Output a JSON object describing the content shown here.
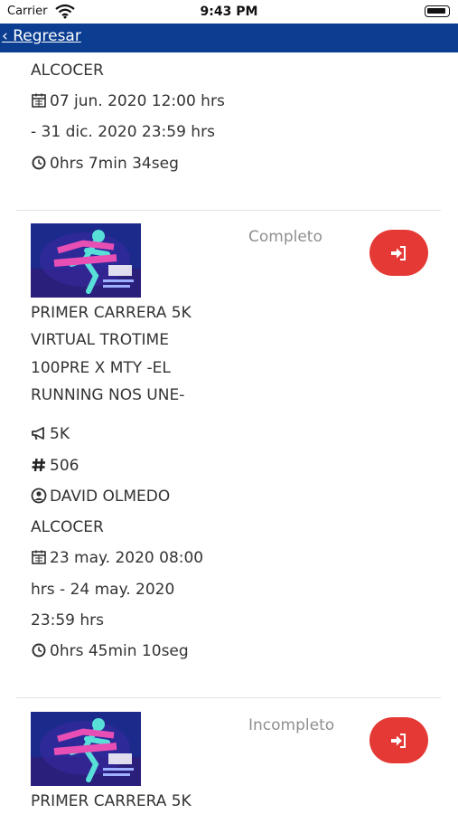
{
  "status_bar": {
    "carrier": "Carrier",
    "time": "9:43 PM"
  },
  "nav": {
    "back_label": "‹ Regresar"
  },
  "entry0": {
    "name_tail": "ALCOCER",
    "date_line1": "07 jun. 2020 12:00 hrs",
    "date_line2": "- 31 dic. 2020 23:59 hrs",
    "duration": "0hrs 7min 34seg"
  },
  "entry1": {
    "status": "Completo",
    "title_lines": [
      "PRIMER CARRERA 5K",
      "VIRTUAL TROTIME",
      "100PRE X MTY -EL",
      "RUNNING NOS UNE-"
    ],
    "distance": "5K",
    "number": "506",
    "name_line1": "DAVID OLMEDO",
    "name_line2": "ALCOCER",
    "date_line1": "23 may. 2020 08:00",
    "date_line2": "hrs - 24 may. 2020",
    "date_line3": "23:59 hrs",
    "duration": "0hrs 45min 10seg"
  },
  "entry2": {
    "status": "Incompleto",
    "title_line1": "PRIMER CARRERA 5K"
  },
  "icons": {
    "calendar": "calendar-icon",
    "clock": "clock-icon",
    "megaphone": "megaphone-icon",
    "hash": "hash-icon",
    "user": "user-circle-icon",
    "sign_in": "sign-in-icon"
  },
  "colors": {
    "nav_bg": "#0b3d91",
    "button_red": "#e53935",
    "status_gray": "#8f8f8f"
  }
}
